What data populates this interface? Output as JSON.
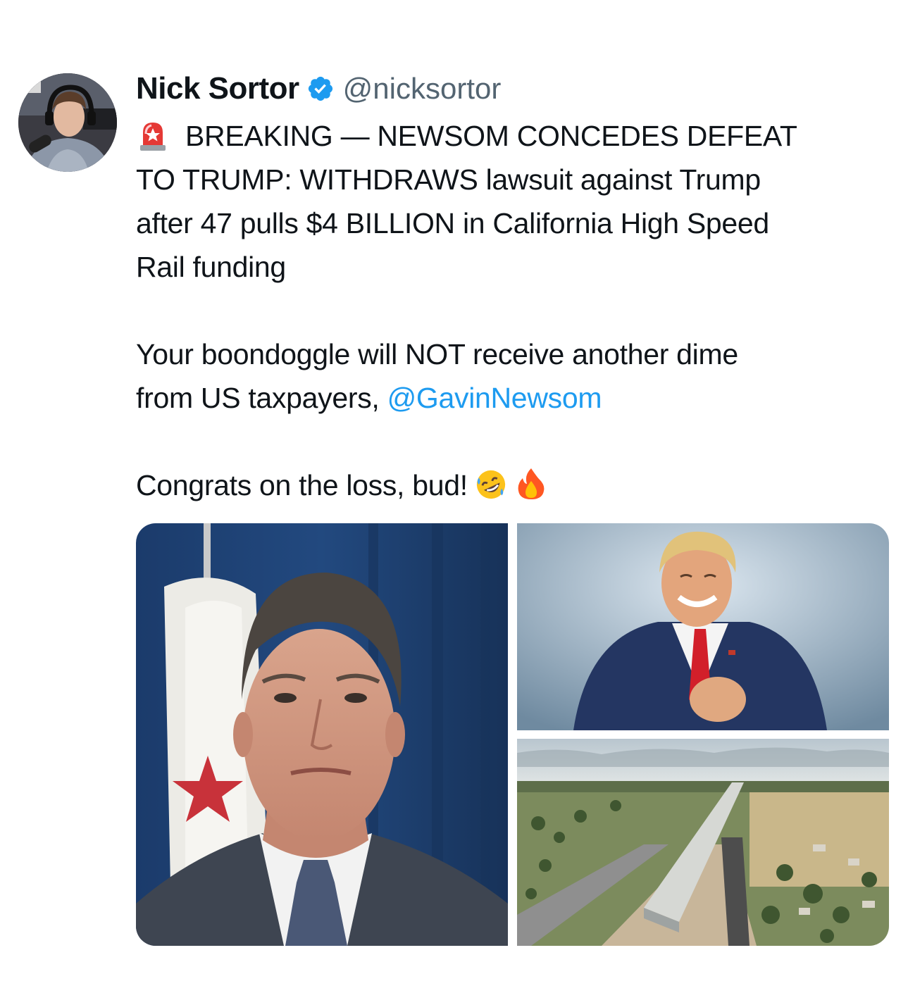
{
  "tweet": {
    "author": {
      "display_name": "Nick Sortor",
      "handle": "@nicksortor",
      "verified": true,
      "avatar_icon": "avatar-photo"
    },
    "text": {
      "line1": "BREAKING — NEWSOM CONCEDES DEFEAT",
      "line2": "TO TRUMP: WITHDRAWS lawsuit against Trump",
      "line3": "after 47 pulls $4 BILLION in California High Speed",
      "line4": "Rail funding",
      "line5": "Your boondoggle will NOT receive another dime",
      "line6_prefix": "from US taxpayers, ",
      "line6_mention": "@GavinNewsom",
      "line7": "Congrats on the loss, bud!"
    },
    "emojis": {
      "leading": "police-siren-icon",
      "trailing": [
        "rolling-laughing-icon",
        "fire-icon"
      ]
    },
    "media": [
      {
        "name": "photo-newsom",
        "description_icon": "photo"
      },
      {
        "name": "photo-trump",
        "description_icon": "photo"
      },
      {
        "name": "photo-rail-construction",
        "description_icon": "photo"
      }
    ]
  },
  "colors": {
    "text": "#0f1419",
    "secondary_text": "#536471",
    "link": "#1d9bf0",
    "verified_badge": "#1d9bf0",
    "background": "#ffffff"
  }
}
